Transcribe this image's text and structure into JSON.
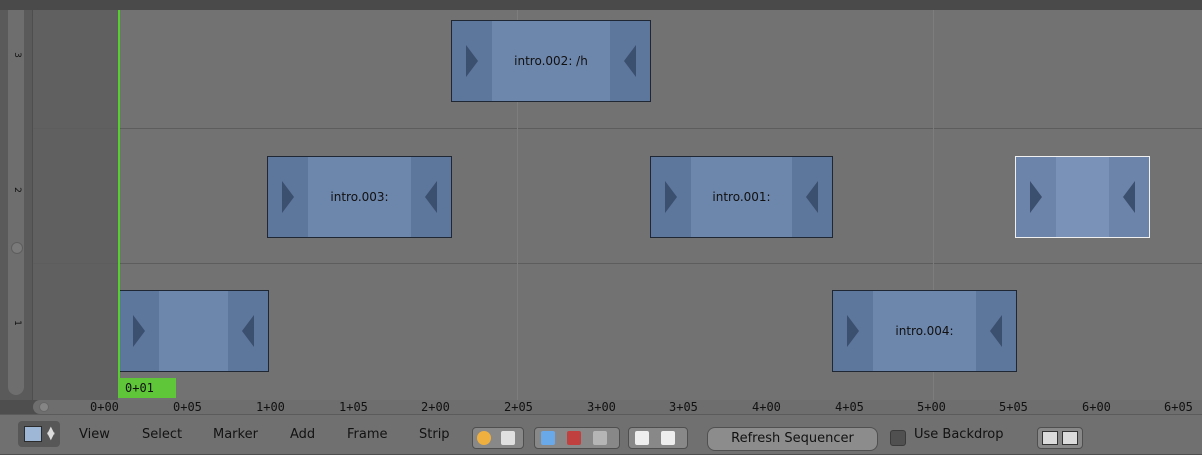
{
  "channels": [
    {
      "label": "3"
    },
    {
      "label": "2"
    },
    {
      "label": "1"
    }
  ],
  "strips": [
    {
      "name": "intro.002: /h",
      "channel": 3,
      "selected": false
    },
    {
      "name": "intro.003:",
      "channel": 2,
      "selected": false
    },
    {
      "name": "intro.001:",
      "channel": 2,
      "selected": false
    },
    {
      "name": "",
      "channel": 2,
      "selected": true
    },
    {
      "name": "",
      "channel": 1,
      "selected": false
    },
    {
      "name": "intro.004:",
      "channel": 1,
      "selected": false
    }
  ],
  "playhead": {
    "frame_label": "0+01"
  },
  "ruler": {
    "ticks": [
      "0+00",
      "0+05",
      "1+00",
      "1+05",
      "2+00",
      "2+05",
      "3+00",
      "3+05",
      "4+00",
      "4+05",
      "5+00",
      "5+05",
      "6+00",
      "6+05"
    ]
  },
  "header": {
    "menus": [
      "View",
      "Select",
      "Marker",
      "Add",
      "Frame",
      "Strip"
    ],
    "refresh_label": "Refresh Sequencer",
    "use_backdrop_label": "Use Backdrop",
    "use_backdrop_checked": false
  },
  "colors": {
    "strip_fill": "#6d86ac",
    "playhead": "#56d02f",
    "background": "#727272"
  }
}
